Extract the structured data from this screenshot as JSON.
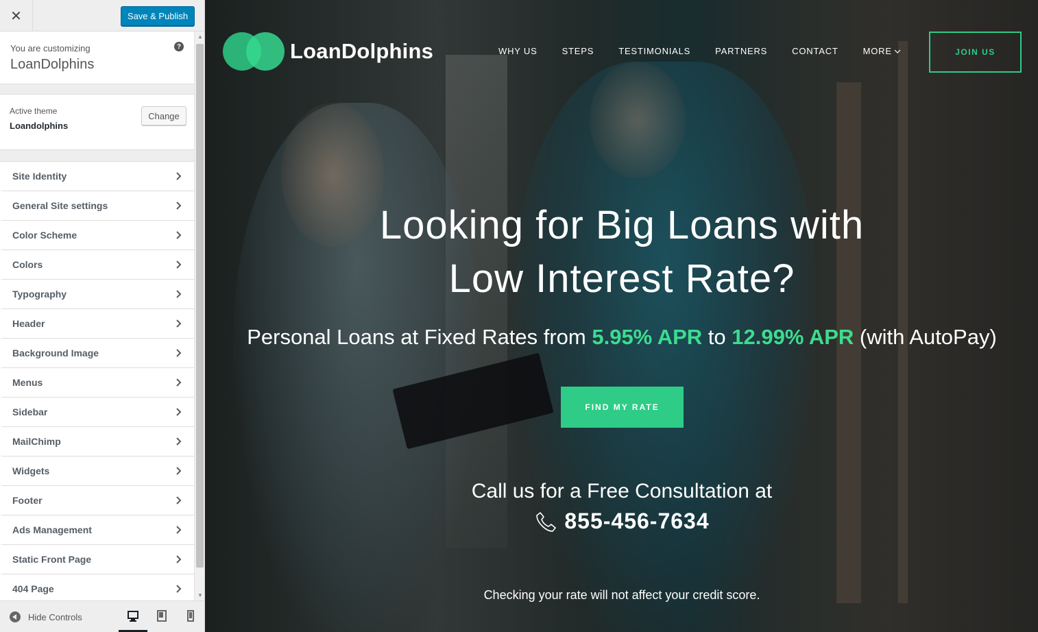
{
  "customizer": {
    "close_icon": "close-icon",
    "save_label": "Save & Publish",
    "customizing_label": "You are customizing",
    "site_name": "LoanDolphins",
    "help_icon_glyph": "?",
    "active_theme_label": "Active theme",
    "active_theme_name": "Loandolphins",
    "change_label": "Change",
    "panels": [
      {
        "label": "Site Identity"
      },
      {
        "label": "General Site settings"
      },
      {
        "label": "Color Scheme"
      },
      {
        "label": "Colors"
      },
      {
        "label": "Typography"
      },
      {
        "label": "Header"
      },
      {
        "label": "Background Image"
      },
      {
        "label": "Menus"
      },
      {
        "label": "Sidebar"
      },
      {
        "label": "MailChimp"
      },
      {
        "label": "Widgets"
      },
      {
        "label": "Footer"
      },
      {
        "label": "Ads Management"
      },
      {
        "label": "Static Front Page"
      },
      {
        "label": "404 Page"
      }
    ],
    "hide_controls_label": "Hide Controls",
    "devices": [
      "desktop",
      "tablet",
      "mobile"
    ],
    "active_device": "desktop",
    "accent_color": "#0085ba"
  },
  "site": {
    "logo_text": "LoanDolphins",
    "brand_color": "#2ecc87",
    "nav": [
      {
        "label": "WHY US"
      },
      {
        "label": "STEPS"
      },
      {
        "label": "TESTIMONIALS"
      },
      {
        "label": "PARTNERS"
      },
      {
        "label": "CONTACT"
      },
      {
        "label": "MORE"
      }
    ],
    "join_label": "JOIN US",
    "headline_line1": "Looking for Big Loans with",
    "headline_line2": "Low Interest Rate?",
    "sub_prefix": "Personal Loans at Fixed Rates from ",
    "rate_low": "5.95% APR",
    "sub_middle": " to ",
    "rate_high": "12.99% APR",
    "sub_suffix": " (with AutoPay)",
    "cta_label": "FIND MY RATE",
    "call_text": "Call us for a Free Consultation at",
    "phone": "855-456-7634",
    "disclaimer": "Checking your rate will not affect your credit score."
  }
}
